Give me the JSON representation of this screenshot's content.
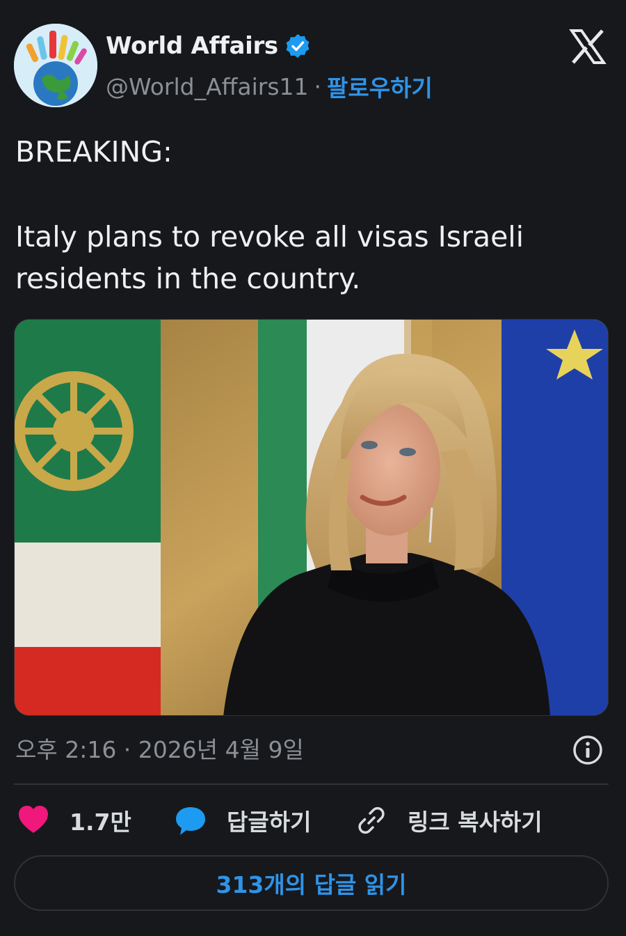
{
  "author": {
    "display_name": "World Affairs",
    "handle": "@World_Affairs11",
    "separator": "·",
    "follow_label": "팔로우하기",
    "verified": true,
    "avatar_icon": "globe-hands-icon"
  },
  "tweet": {
    "line1": "BREAKING:",
    "line2": "Italy plans to revoke all visas Israeli",
    "line3": "residents in the country.",
    "timestamp": "오후 2:16 · 2026년 4월 9일"
  },
  "actions": {
    "likes_count": "1.7만",
    "reply_label": "답글하기",
    "copy_link_label": "링크 복사하기"
  },
  "read_replies_label": "313개의 답글 읽기",
  "colors": {
    "background": "#17181c",
    "accent": "#2f94e8",
    "like": "#f0187a",
    "reply_icon": "#1d9bf0",
    "muted": "#8b9095"
  }
}
